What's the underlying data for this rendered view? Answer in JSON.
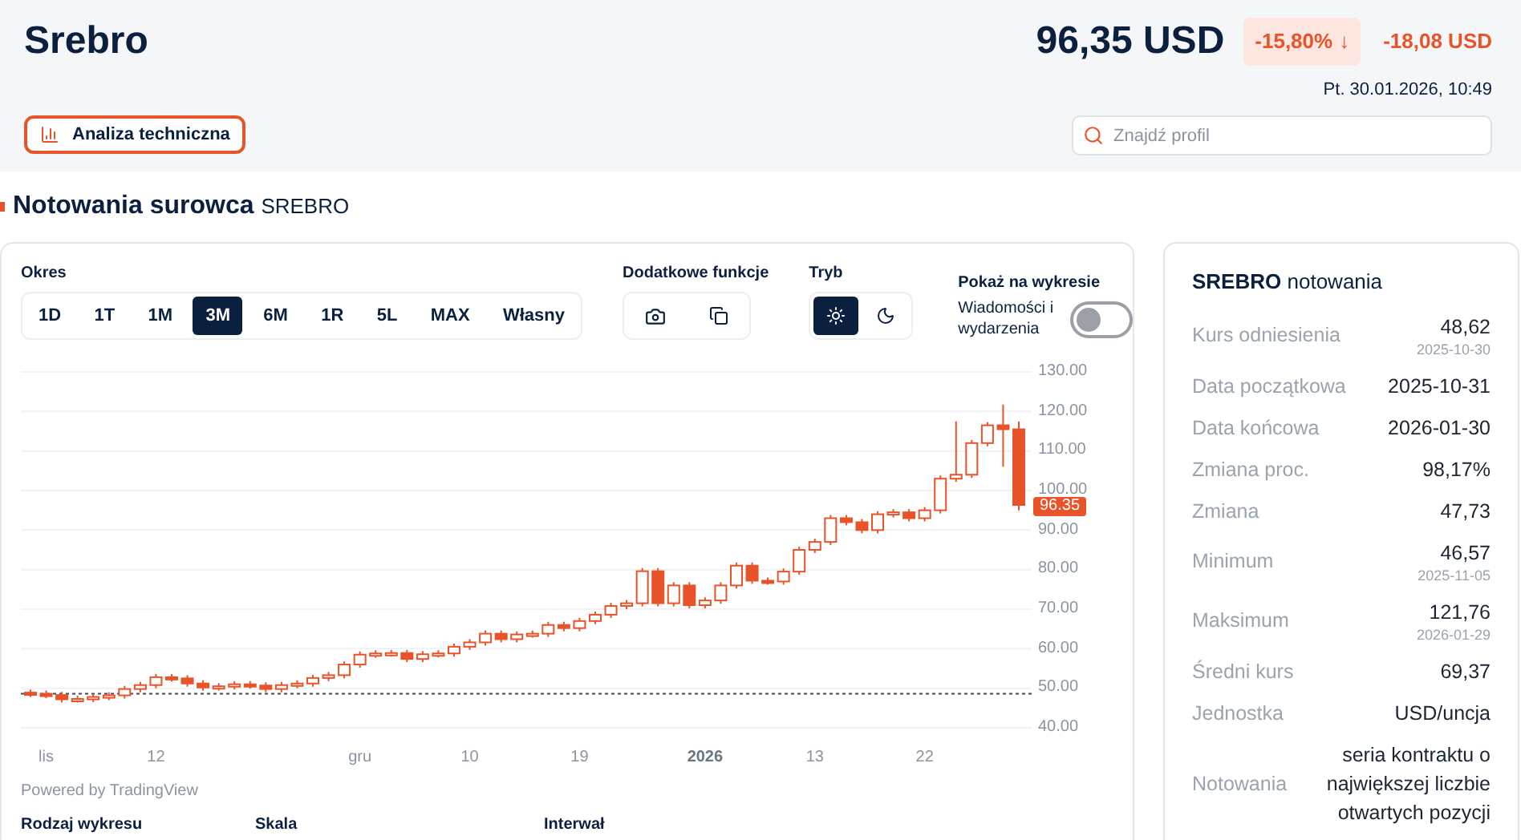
{
  "header": {
    "title": "Srebro",
    "price": "96,35 USD",
    "change_pct": "-15,80%",
    "change_pct_arrow": "↓",
    "change_abs": "-18,08 USD",
    "timestamp": "Pt. 30.01.2026, 10:49",
    "tech_button": "Analiza techniczna",
    "search": {
      "placeholder": "Znajdź profil"
    }
  },
  "section": {
    "title": "Notowania surowca",
    "subtitle": "SREBRO"
  },
  "controls": {
    "period_label": "Okres",
    "periods": [
      {
        "label": "1D",
        "selected": false
      },
      {
        "label": "1T",
        "selected": false
      },
      {
        "label": "1M",
        "selected": false
      },
      {
        "label": "3M",
        "selected": true
      },
      {
        "label": "6M",
        "selected": false
      },
      {
        "label": "1R",
        "selected": false
      },
      {
        "label": "5L",
        "selected": false
      },
      {
        "label": "MAX",
        "selected": false
      },
      {
        "label": "Własny",
        "selected": false
      }
    ],
    "extra_label": "Dodatkowe funkcje",
    "mode_label": "Tryb",
    "modes": [
      {
        "kind": "light",
        "selected": true
      },
      {
        "kind": "dark",
        "selected": false
      }
    ],
    "show_label": "Pokaż na wykresie",
    "news_label": "Wiadomości i wydarzenia",
    "news_on": false
  },
  "chart": {
    "chart_data": {
      "type": "candlestick",
      "categories": [
        null,
        "lis",
        null,
        null,
        null,
        null,
        null,
        null,
        "12",
        null,
        null,
        null,
        null,
        null,
        null,
        null,
        null,
        null,
        null,
        null,
        null,
        "gru",
        null,
        null,
        null,
        null,
        null,
        null,
        "10",
        null,
        null,
        null,
        null,
        null,
        null,
        "19",
        null,
        null,
        null,
        null,
        null,
        null,
        null,
        "2026",
        null,
        null,
        null,
        null,
        null,
        null,
        "13",
        null,
        null,
        null,
        null,
        null,
        null,
        "22",
        null,
        null,
        null,
        null,
        null,
        null
      ],
      "ohlc": [
        [
          48.9,
          49.7,
          47.8,
          48.6
        ],
        [
          48.6,
          49.4,
          47.5,
          48.3
        ],
        [
          48.3,
          49.1,
          46.4,
          47.2
        ],
        [
          47.2,
          48.1,
          46.4,
          47.3
        ],
        [
          47.3,
          48.6,
          46.5,
          47.8
        ],
        [
          47.8,
          49.0,
          47.0,
          48.2
        ],
        [
          48.2,
          50.6,
          47.4,
          49.8
        ],
        [
          49.8,
          51.6,
          49.0,
          50.8
        ],
        [
          50.8,
          53.6,
          50.0,
          52.8
        ],
        [
          52.8,
          53.6,
          51.7,
          52.5
        ],
        [
          52.5,
          53.3,
          50.4,
          51.2
        ],
        [
          51.2,
          52.0,
          49.4,
          50.2
        ],
        [
          50.2,
          51.3,
          49.4,
          50.5
        ],
        [
          50.5,
          51.8,
          49.7,
          51.0
        ],
        [
          51.0,
          51.8,
          49.9,
          50.7
        ],
        [
          50.7,
          51.5,
          49.0,
          49.8
        ],
        [
          49.8,
          51.6,
          49.0,
          50.8
        ],
        [
          50.8,
          52.0,
          50.0,
          51.2
        ],
        [
          51.2,
          53.4,
          50.4,
          52.6
        ],
        [
          52.6,
          54.1,
          51.8,
          53.3
        ],
        [
          53.3,
          56.8,
          52.5,
          56.0
        ],
        [
          56.0,
          59.3,
          55.2,
          58.5
        ],
        [
          58.5,
          59.6,
          57.7,
          58.8
        ],
        [
          58.8,
          59.7,
          58.0,
          58.9
        ],
        [
          58.9,
          59.7,
          56.6,
          57.4
        ],
        [
          57.4,
          59.4,
          56.6,
          58.6
        ],
        [
          58.6,
          59.6,
          57.8,
          58.8
        ],
        [
          58.8,
          61.3,
          58.0,
          60.5
        ],
        [
          60.5,
          62.4,
          59.7,
          61.6
        ],
        [
          61.6,
          64.6,
          60.8,
          63.8
        ],
        [
          63.8,
          64.6,
          61.6,
          62.4
        ],
        [
          62.4,
          64.4,
          61.6,
          63.6
        ],
        [
          63.6,
          64.6,
          62.8,
          63.8
        ],
        [
          63.8,
          66.8,
          63.0,
          66.0
        ],
        [
          66.0,
          66.8,
          64.4,
          65.2
        ],
        [
          65.2,
          67.8,
          64.4,
          67.0
        ],
        [
          67.0,
          69.4,
          66.2,
          68.6
        ],
        [
          68.6,
          71.6,
          67.8,
          70.8
        ],
        [
          70.8,
          72.3,
          70.0,
          71.5
        ],
        [
          71.5,
          80.4,
          70.7,
          79.6
        ],
        [
          79.6,
          80.4,
          70.7,
          71.5
        ],
        [
          71.5,
          76.8,
          70.7,
          76.0
        ],
        [
          76.0,
          76.8,
          70.2,
          71.0
        ],
        [
          71.0,
          73.0,
          70.2,
          72.2
        ],
        [
          72.2,
          76.8,
          71.4,
          76.0
        ],
        [
          76.0,
          81.8,
          75.2,
          81.0
        ],
        [
          81.0,
          81.8,
          76.4,
          77.2
        ],
        [
          77.2,
          78.0,
          76.2,
          77.0
        ],
        [
          77.0,
          80.3,
          76.2,
          79.5
        ],
        [
          79.5,
          85.8,
          78.7,
          85.0
        ],
        [
          85.0,
          87.8,
          84.2,
          87.0
        ],
        [
          87.0,
          93.8,
          86.2,
          93.0
        ],
        [
          93.0,
          93.8,
          91.2,
          92.0
        ],
        [
          92.0,
          92.8,
          89.2,
          90.0
        ],
        [
          90.0,
          94.8,
          89.2,
          94.0
        ],
        [
          94.0,
          95.3,
          93.2,
          94.5
        ],
        [
          94.5,
          95.3,
          92.2,
          93.0
        ],
        [
          93.0,
          95.8,
          92.2,
          95.0
        ],
        [
          95.0,
          103.8,
          94.2,
          103.0
        ],
        [
          103.0,
          117.5,
          102.2,
          104.0
        ],
        [
          104.0,
          112.8,
          103.2,
          112.0
        ],
        [
          112.0,
          117.3,
          111.2,
          116.5
        ],
        [
          116.5,
          121.76,
          106.0,
          115.5
        ],
        [
          115.5,
          117.5,
          95.0,
          96.35
        ]
      ],
      "ylim": [
        40,
        130
      ],
      "yticks": [
        {
          "value": 130,
          "label": "130.00"
        },
        {
          "value": 120,
          "label": "120.00"
        },
        {
          "value": 110,
          "label": "110.00"
        },
        {
          "value": 100,
          "label": "100.00"
        },
        {
          "value": 90,
          "label": "90.00"
        },
        {
          "value": 80,
          "label": "80.00"
        },
        {
          "value": 70,
          "label": "70.00"
        },
        {
          "value": 60,
          "label": "60.00"
        },
        {
          "value": 50,
          "label": "50.00"
        },
        {
          "value": 40,
          "label": "40.00"
        }
      ],
      "ref_lines": [
        {
          "axis": "y",
          "value": 48.62
        }
      ],
      "grid": true
    },
    "last_price": "96.35",
    "bold_xticks": [
      false,
      false,
      false,
      false,
      false,
      true,
      false,
      false
    ],
    "credit": "Powered by TradingView"
  },
  "bottom_labels": [
    "Rodzaj wykresu",
    "Skala",
    "Interwał"
  ],
  "stats": {
    "title": "SREBRO",
    "title_suffix": "notowania",
    "rows": [
      {
        "label": "Kurs odniesienia",
        "value": "48,62",
        "date": "2025-10-30"
      },
      {
        "label": "Data początkowa",
        "value": "2025-10-31"
      },
      {
        "label": "Data końcowa",
        "value": "2026-01-30"
      },
      {
        "label": "Zmiana proc.",
        "value": "98,17%"
      },
      {
        "label": "Zmiana",
        "value": "47,73"
      },
      {
        "label": "Minimum",
        "value": "46,57",
        "date": "2025-11-05"
      },
      {
        "label": "Maksimum",
        "value": "121,76",
        "date": "2026-01-29"
      },
      {
        "label": "Średni kurs",
        "value": "69,37"
      },
      {
        "label": "Jednostka",
        "value": "USD/uncja"
      },
      {
        "label": "Notowania",
        "value": "seria kontraktu o największej liczbie otwartych pozycji"
      }
    ]
  }
}
